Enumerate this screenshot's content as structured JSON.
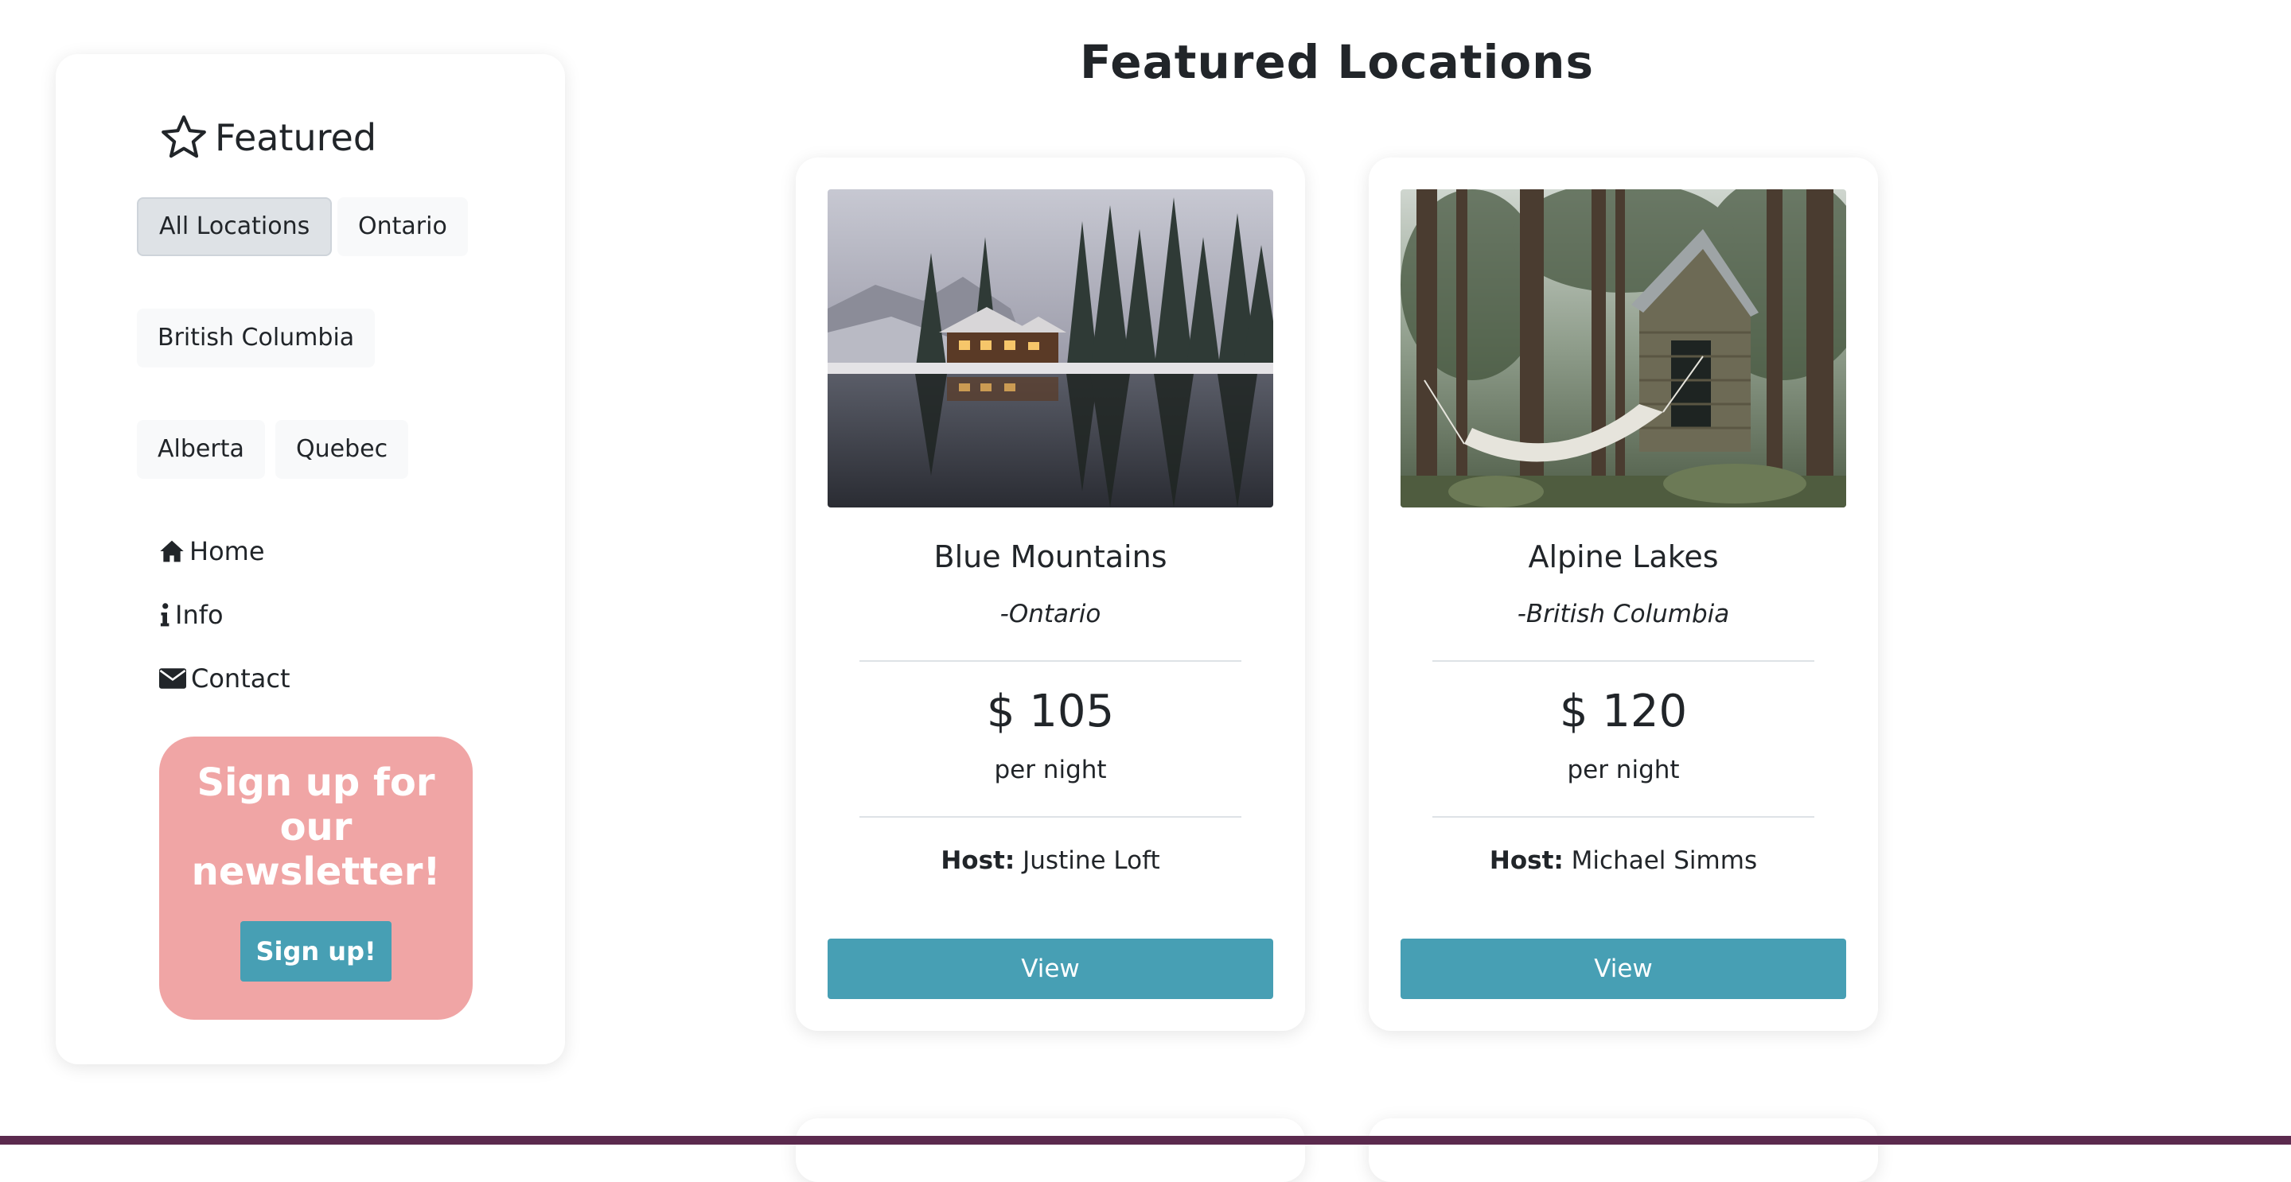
{
  "sidebar": {
    "heading": "Featured",
    "filters": [
      "All Locations",
      "Ontario",
      "British Columbia",
      "Alberta",
      "Quebec"
    ],
    "active_filter": "All Locations",
    "nav": [
      {
        "label": "Home",
        "icon": "home-icon"
      },
      {
        "label": "Info",
        "icon": "info-icon"
      },
      {
        "label": "Contact",
        "icon": "envelope-icon"
      }
    ],
    "newsletter": {
      "title": "Sign up for our newsletter!",
      "button": "Sign up!"
    }
  },
  "main": {
    "title": "Featured Locations",
    "cards": [
      {
        "name": "Blue Mountains",
        "region": "-Ontario",
        "price": "$ 105",
        "price_unit": "per night",
        "host_label": "Host:",
        "host_name": "Justine Loft",
        "button": "View",
        "image": "snowy lakeside cabin"
      },
      {
        "name": "Alpine Lakes",
        "region": "-British Columbia",
        "price": "$ 120",
        "price_unit": "per night",
        "host_label": "Host:",
        "host_name": "Michael Simms",
        "button": "View",
        "image": "forest cabin with hammock"
      }
    ]
  },
  "colors": {
    "accent": "#479fb4",
    "newsletter_bg": "#f0a5a5",
    "active_filter_bg": "#dee2e6",
    "filter_bg": "#f8f9fa",
    "bottom_bar": "#5b2a4e"
  }
}
